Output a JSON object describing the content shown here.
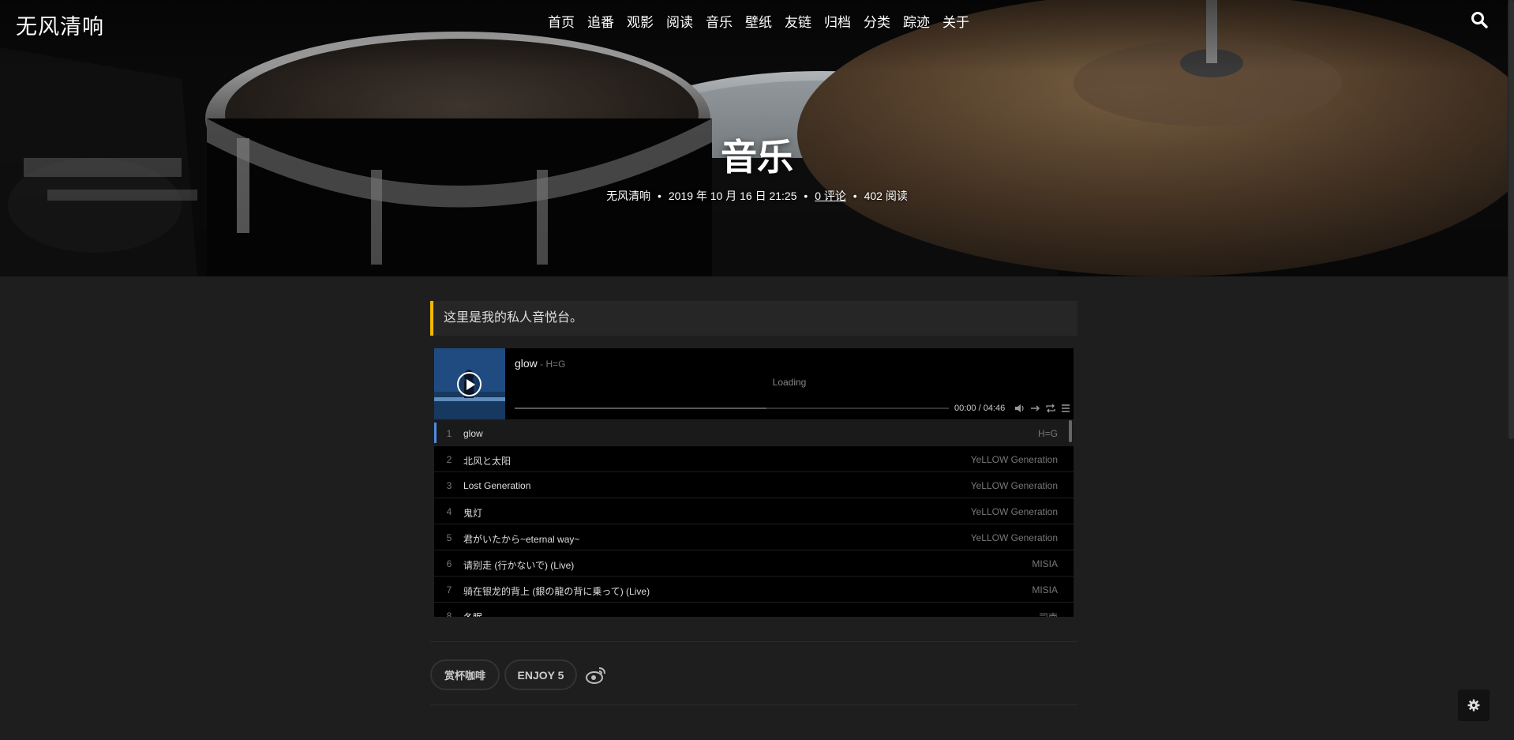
{
  "site": {
    "logo": "无风清响"
  },
  "nav": {
    "items": [
      {
        "label": "首页"
      },
      {
        "label": "追番"
      },
      {
        "label": "观影"
      },
      {
        "label": "阅读"
      },
      {
        "label": "音乐"
      },
      {
        "label": "壁纸"
      },
      {
        "label": "友链"
      },
      {
        "label": "归档"
      },
      {
        "label": "分类"
      },
      {
        "label": "踪迹"
      },
      {
        "label": "关于"
      }
    ],
    "search_icon": "search-icon"
  },
  "post": {
    "title": "音乐",
    "author": "无风清响",
    "bullet": "•",
    "date": "2019 年 10 月 16 日 21:25",
    "comments": "0 评论",
    "views": "402 阅读"
  },
  "content": {
    "quote": "这里是我的私人音悦台。"
  },
  "player": {
    "current_title": "glow",
    "current_artist": " - H=G",
    "lrc": "Loading",
    "time": "00:00 / 04:46",
    "loaded_fraction": 0.58,
    "playlist": [
      {
        "index": "1",
        "title": "glow",
        "artist": "H=G",
        "active": true
      },
      {
        "index": "2",
        "title": "北风と太阳",
        "artist": "YeLLOW Generation"
      },
      {
        "index": "3",
        "title": "Lost Generation",
        "artist": "YeLLOW Generation"
      },
      {
        "index": "4",
        "title": "鬼灯",
        "artist": "YeLLOW Generation"
      },
      {
        "index": "5",
        "title": "君がいたから~eternal way~",
        "artist": "YeLLOW Generation"
      },
      {
        "index": "6",
        "title": "请别走 (行かないで) (Live)",
        "artist": "MISIA"
      },
      {
        "index": "7",
        "title": "骑在银龙的背上 (銀の龍の背に乗って) (Live)",
        "artist": "MISIA"
      },
      {
        "index": "8",
        "title": "冬眠",
        "artist": "司南"
      }
    ]
  },
  "actions": {
    "coffee": "赏杯咖啡",
    "enjoy": "ENJOY 5"
  },
  "colors": {
    "accent": "#f5b800",
    "active_song": "#4a8ce0",
    "background": "#1e1e1e"
  }
}
